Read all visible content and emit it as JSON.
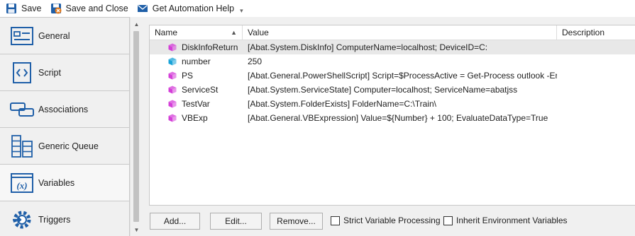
{
  "toolbar": {
    "save_label": "Save",
    "save_close_label": "Save and Close",
    "help_label": "Get Automation Help"
  },
  "nav": {
    "items": [
      {
        "label": "General",
        "icon": "general-icon"
      },
      {
        "label": "Script",
        "icon": "script-icon"
      },
      {
        "label": "Associations",
        "icon": "associations-icon"
      },
      {
        "label": "Generic Queue",
        "icon": "queue-icon"
      },
      {
        "label": "Variables",
        "icon": "variables-icon"
      },
      {
        "label": "Triggers",
        "icon": "triggers-icon"
      }
    ],
    "active": "Variables"
  },
  "grid": {
    "columns": [
      "Name",
      "Value",
      "Description"
    ],
    "rows": [
      {
        "name": "DiskInfoReturn",
        "value": "[Abat.System.DiskInfo] ComputerName=localhost; DeviceID=C:",
        "type": "object"
      },
      {
        "name": "number",
        "value": "250",
        "type": "primitive"
      },
      {
        "name": "PS",
        "value": "[Abat.General.PowerShellScript] Script=$ProcessActive = Get-Process outlook -Er",
        "type": "object"
      },
      {
        "name": "ServiceSt",
        "value": "[Abat.System.ServiceState] Computer=localhost; ServiceName=abatjss",
        "type": "object"
      },
      {
        "name": "TestVar",
        "value": "[Abat.System.FolderExists] FolderName=C:\\Train\\",
        "type": "object"
      },
      {
        "name": "VBExp",
        "value": "[Abat.General.VBExpression] Value=${Number} + 100; EvaluateDataType=True",
        "type": "object"
      }
    ]
  },
  "actions": {
    "add_label": "Add...",
    "edit_label": "Edit...",
    "remove_label": "Remove...",
    "strict_label": "Strict Variable Processing",
    "inherit_label": "Inherit Environment Variables"
  },
  "colors": {
    "accent": "#1f5fa8",
    "object_cube": "#d43fd8",
    "primitive_cube": "#1aa3d8"
  }
}
